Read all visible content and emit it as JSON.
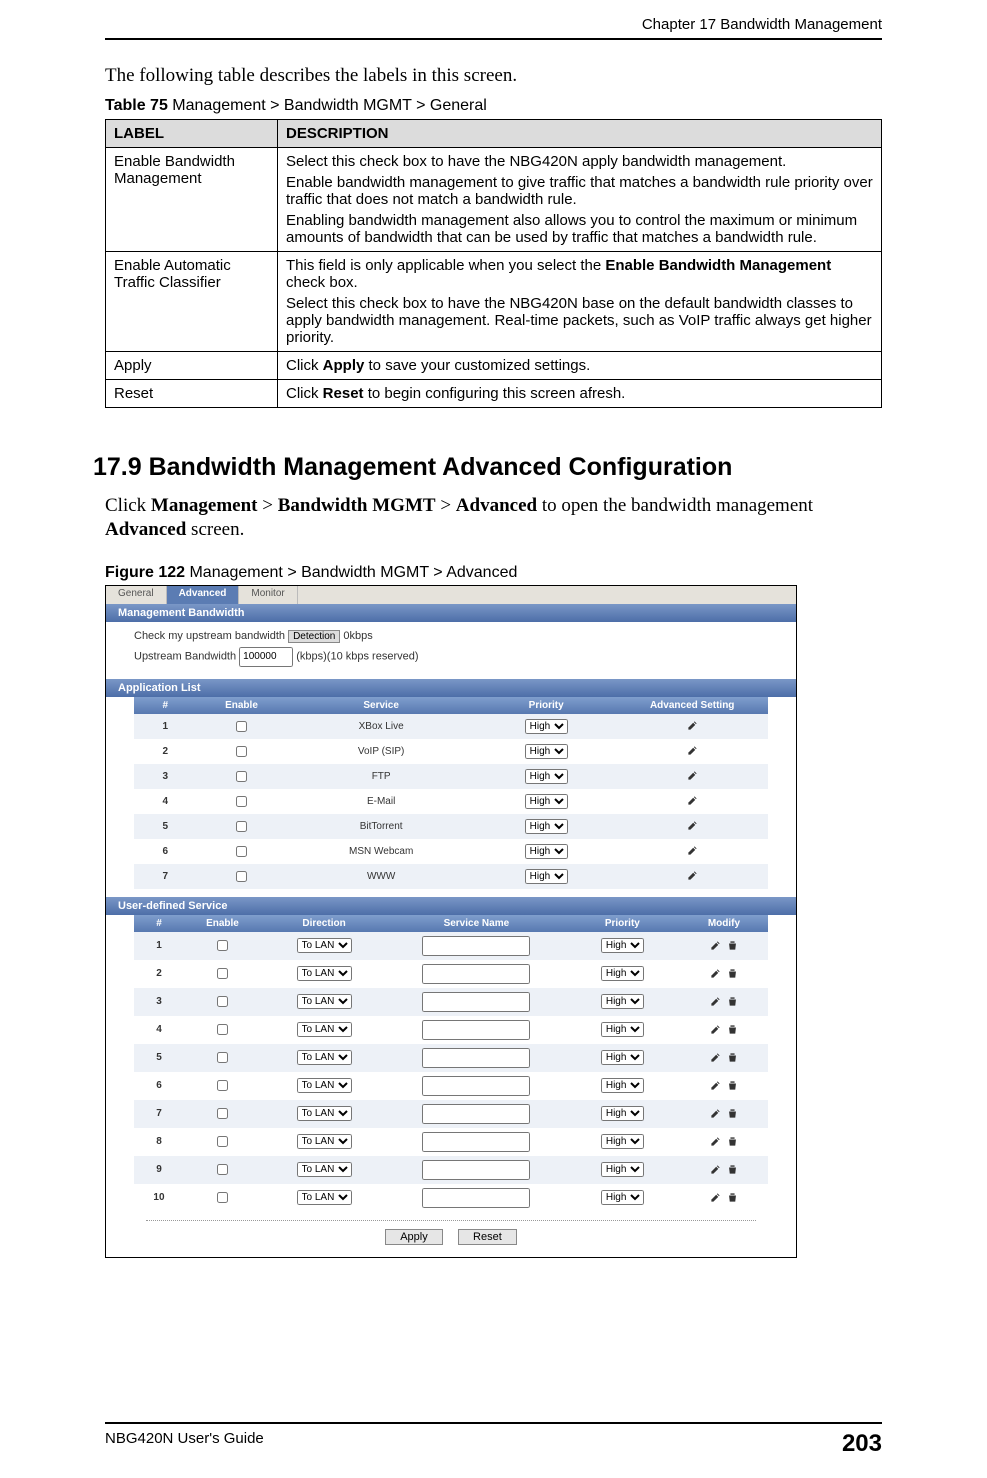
{
  "header": {
    "chapter": "Chapter 17 Bandwidth Management"
  },
  "intro_text": "The following table describes the labels in this screen.",
  "table75": {
    "caption_bold": "Table 75",
    "caption_rest": "   Management > Bandwidth MGMT > General",
    "head_label": "LABEL",
    "head_desc": "DESCRIPTION",
    "rows": [
      {
        "label": "Enable Bandwidth Management",
        "desc_p1": "Select this check box to have the NBG420N apply bandwidth management.",
        "desc_p2": "Enable bandwidth management to give traffic that matches a bandwidth rule priority over traffic that does not match a bandwidth rule.",
        "desc_p3": "Enabling bandwidth management also allows you to control the maximum or minimum amounts of bandwidth that can be used by traffic that matches a bandwidth rule."
      },
      {
        "label": "Enable Automatic Traffic Classifier",
        "desc_p1_pre": "This field is only applicable when you select the ",
        "desc_p1_bold": "Enable Bandwidth Management",
        "desc_p1_post": " check box.",
        "desc_p2": "Select this check box to have the NBG420N base on the default bandwidth classes to apply bandwidth management. Real-time packets, such as VoIP traffic always get higher priority."
      },
      {
        "label": "Apply",
        "desc_pre": "Click ",
        "desc_bold": "Apply",
        "desc_post": " to save your customized settings."
      },
      {
        "label": "Reset",
        "desc_pre": "Click ",
        "desc_bold": "Reset",
        "desc_post": " to begin configuring this screen afresh."
      }
    ]
  },
  "section": {
    "heading": "17.9  Bandwidth Management Advanced Configuration",
    "body_pre": "Click ",
    "b1": "Management",
    "gt1": " > ",
    "b2": "Bandwidth MGMT",
    "gt2": " > ",
    "b3": "Advanced",
    "mid": " to open the bandwidth management ",
    "b4": "Advanced",
    "post": " screen."
  },
  "figure": {
    "caption_bold": "Figure 122",
    "caption_rest": "   Management > Bandwidth MGMT > Advanced",
    "tabs": {
      "general": "General",
      "advanced": "Advanced",
      "monitor": "Monitor"
    },
    "mgmt_bw": {
      "title": "Management Bandwidth",
      "check_label": "Check my upstream bandwidth",
      "detect_btn": "Detection",
      "detect_suffix": " 0kbps",
      "upstream_label": "Upstream Bandwidth",
      "upstream_value": "100000",
      "upstream_suffix": "(kbps)(10 kbps reserved)"
    },
    "app_list": {
      "title": "Application List",
      "head": {
        "num": "#",
        "enable": "Enable",
        "service": "Service",
        "priority": "Priority",
        "adv": "Advanced Setting"
      },
      "priority_option": "High",
      "rows": [
        {
          "n": "1",
          "service": "XBox Live"
        },
        {
          "n": "2",
          "service": "VoIP (SIP)"
        },
        {
          "n": "3",
          "service": "FTP"
        },
        {
          "n": "4",
          "service": "E-Mail"
        },
        {
          "n": "5",
          "service": "BitTorrent"
        },
        {
          "n": "6",
          "service": "MSN Webcam"
        },
        {
          "n": "7",
          "service": "WWW"
        }
      ]
    },
    "user_def": {
      "title": "User-defined Service",
      "head": {
        "num": "#",
        "enable": "Enable",
        "direction": "Direction",
        "svcname": "Service Name",
        "priority": "Priority",
        "modify": "Modify"
      },
      "dir_option": "To LAN",
      "priority_option": "High",
      "rows": [
        {
          "n": "1"
        },
        {
          "n": "2"
        },
        {
          "n": "3"
        },
        {
          "n": "4"
        },
        {
          "n": "5"
        },
        {
          "n": "6"
        },
        {
          "n": "7"
        },
        {
          "n": "8"
        },
        {
          "n": "9"
        },
        {
          "n": "10"
        }
      ]
    },
    "buttons": {
      "apply": "Apply",
      "reset": "Reset"
    }
  },
  "footer": {
    "guide": "NBG420N User's Guide",
    "page": "203"
  }
}
